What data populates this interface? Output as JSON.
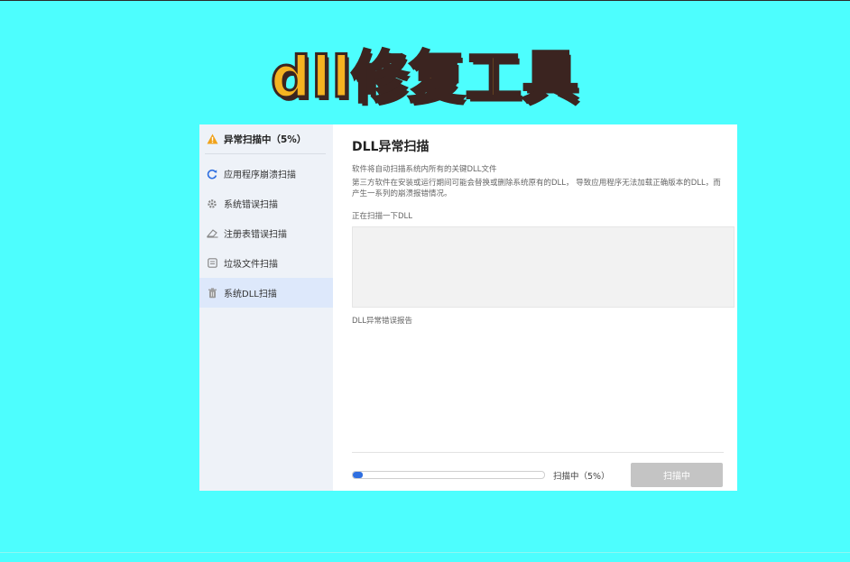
{
  "banner": {
    "title": "dll修复工具"
  },
  "sidebar": {
    "header": {
      "label": "异常扫描中（5%）",
      "icon": "warning-icon"
    },
    "items": [
      {
        "label": "应用程序崩溃扫描",
        "icon": "refresh-icon"
      },
      {
        "label": "系统错误扫描",
        "icon": "gear-icon"
      },
      {
        "label": "注册表错误扫描",
        "icon": "eraser-icon"
      },
      {
        "label": "垃圾文件扫描",
        "icon": "file-box-icon"
      },
      {
        "label": "系统DLL扫描",
        "icon": "trash-icon",
        "active": true
      }
    ]
  },
  "main": {
    "title": "DLL异常扫描",
    "desc1": "软件将自动扫描系统内所有的关键DLL文件",
    "desc2": "第三方软件在安装或运行期间可能会替换或删除系统原有的DLL， 导致应用程序无法加载正确版本的DLL，而产生一系列的崩溃报错情况。",
    "scan_label": "正在扫描一下DLL",
    "report_label": "DLL异常错误报告"
  },
  "footer": {
    "progress_percent": 5,
    "status": "扫描中（5%）",
    "button_label": "扫描中"
  },
  "colors": {
    "background": "#4dfefe",
    "banner_fill": "#f5b321",
    "banner_stroke": "#3b2420",
    "progress": "#2f6fe0",
    "warning": "#f0a21a"
  }
}
